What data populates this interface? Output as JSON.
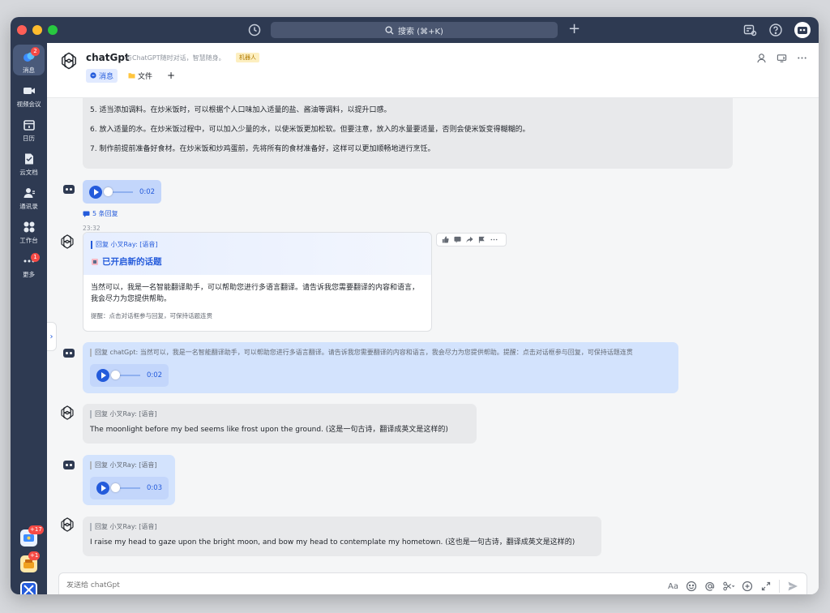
{
  "titlebar": {
    "search_label": "搜索 (⌘+K)"
  },
  "rail": {
    "items": [
      {
        "label": "消息",
        "badge": "2"
      },
      {
        "label": "视频会议"
      },
      {
        "label": "日历"
      },
      {
        "label": "云文档"
      },
      {
        "label": "通讯录"
      },
      {
        "label": "工作台"
      },
      {
        "label": "更多",
        "badge": "1"
      }
    ],
    "apps": [
      {
        "badge": "+17"
      },
      {
        "badge": "+1"
      }
    ]
  },
  "header": {
    "name": "chatGpt",
    "description": "与ChatGPT随时对话，智慧随身。",
    "bot_tag": "机器人",
    "tabs": [
      {
        "label": "消息",
        "active": true
      },
      {
        "label": "文件"
      }
    ],
    "add_tab": "+"
  },
  "messages": {
    "first_answer": {
      "lines": [
        "5. 适当添加调料。在炒米饭时，可以根据个人口味加入适量的盐、酱油等调料，以提升口感。",
        "6. 放入适量的水。在炒米饭过程中，可以加入少量的水，以使米饭更加松软。但要注意，放入的水量要适量，否则会使米饭变得糊糊的。",
        "7. 制作前提前准备好食材。在炒米饭和炒鸡蛋前，先将所有的食材准备好，这样可以更加顺畅地进行烹饪。"
      ]
    },
    "voice1": {
      "duration": "0:02",
      "replies": "5 条回复"
    },
    "timestamp": "23:32",
    "card": {
      "quote": "回复 小叉Ray: [语音]",
      "title": "已开启新的话题",
      "body": "当然可以，我是一名智能翻译助手，可以帮助您进行多语言翻译。请告诉我您需要翻译的内容和语言，我会尽力为您提供帮助。",
      "hint": "提醒：点击对话框参与回复，可保持话题连贯"
    },
    "voice2": {
      "quote": "回复 chatGpt: 当然可以，我是一名智能翻译助手，可以帮助您进行多语言翻译。请告诉我您需要翻译的内容和语言，我会尽力为您提供帮助。提醒：点击对话框参与回复，可保持话题连贯",
      "duration": "0:02"
    },
    "answer2": {
      "quote": "回复 小叉Ray: [语音]",
      "text": "The moonlight before my bed seems like frost upon the ground. (这是一句古诗，翻译成英文是这样的)"
    },
    "voice3": {
      "quote": "回复 小叉Ray: [语音]",
      "duration": "0:03"
    },
    "answer3": {
      "quote": "回复 小叉Ray: [语音]",
      "text": "I raise my head to gaze upon the bright moon, and bow my head to contemplate my hometown. (这也是一句古诗，翻译成英文是这样的)"
    }
  },
  "composer": {
    "placeholder": "发送给 chatGpt",
    "font_tool": "Aa"
  },
  "colors": {
    "rail": "#2e3a52",
    "accent": "#245bdb",
    "bubble_grey": "#e8e9eb",
    "bubble_blue": "#d3e3fd"
  }
}
